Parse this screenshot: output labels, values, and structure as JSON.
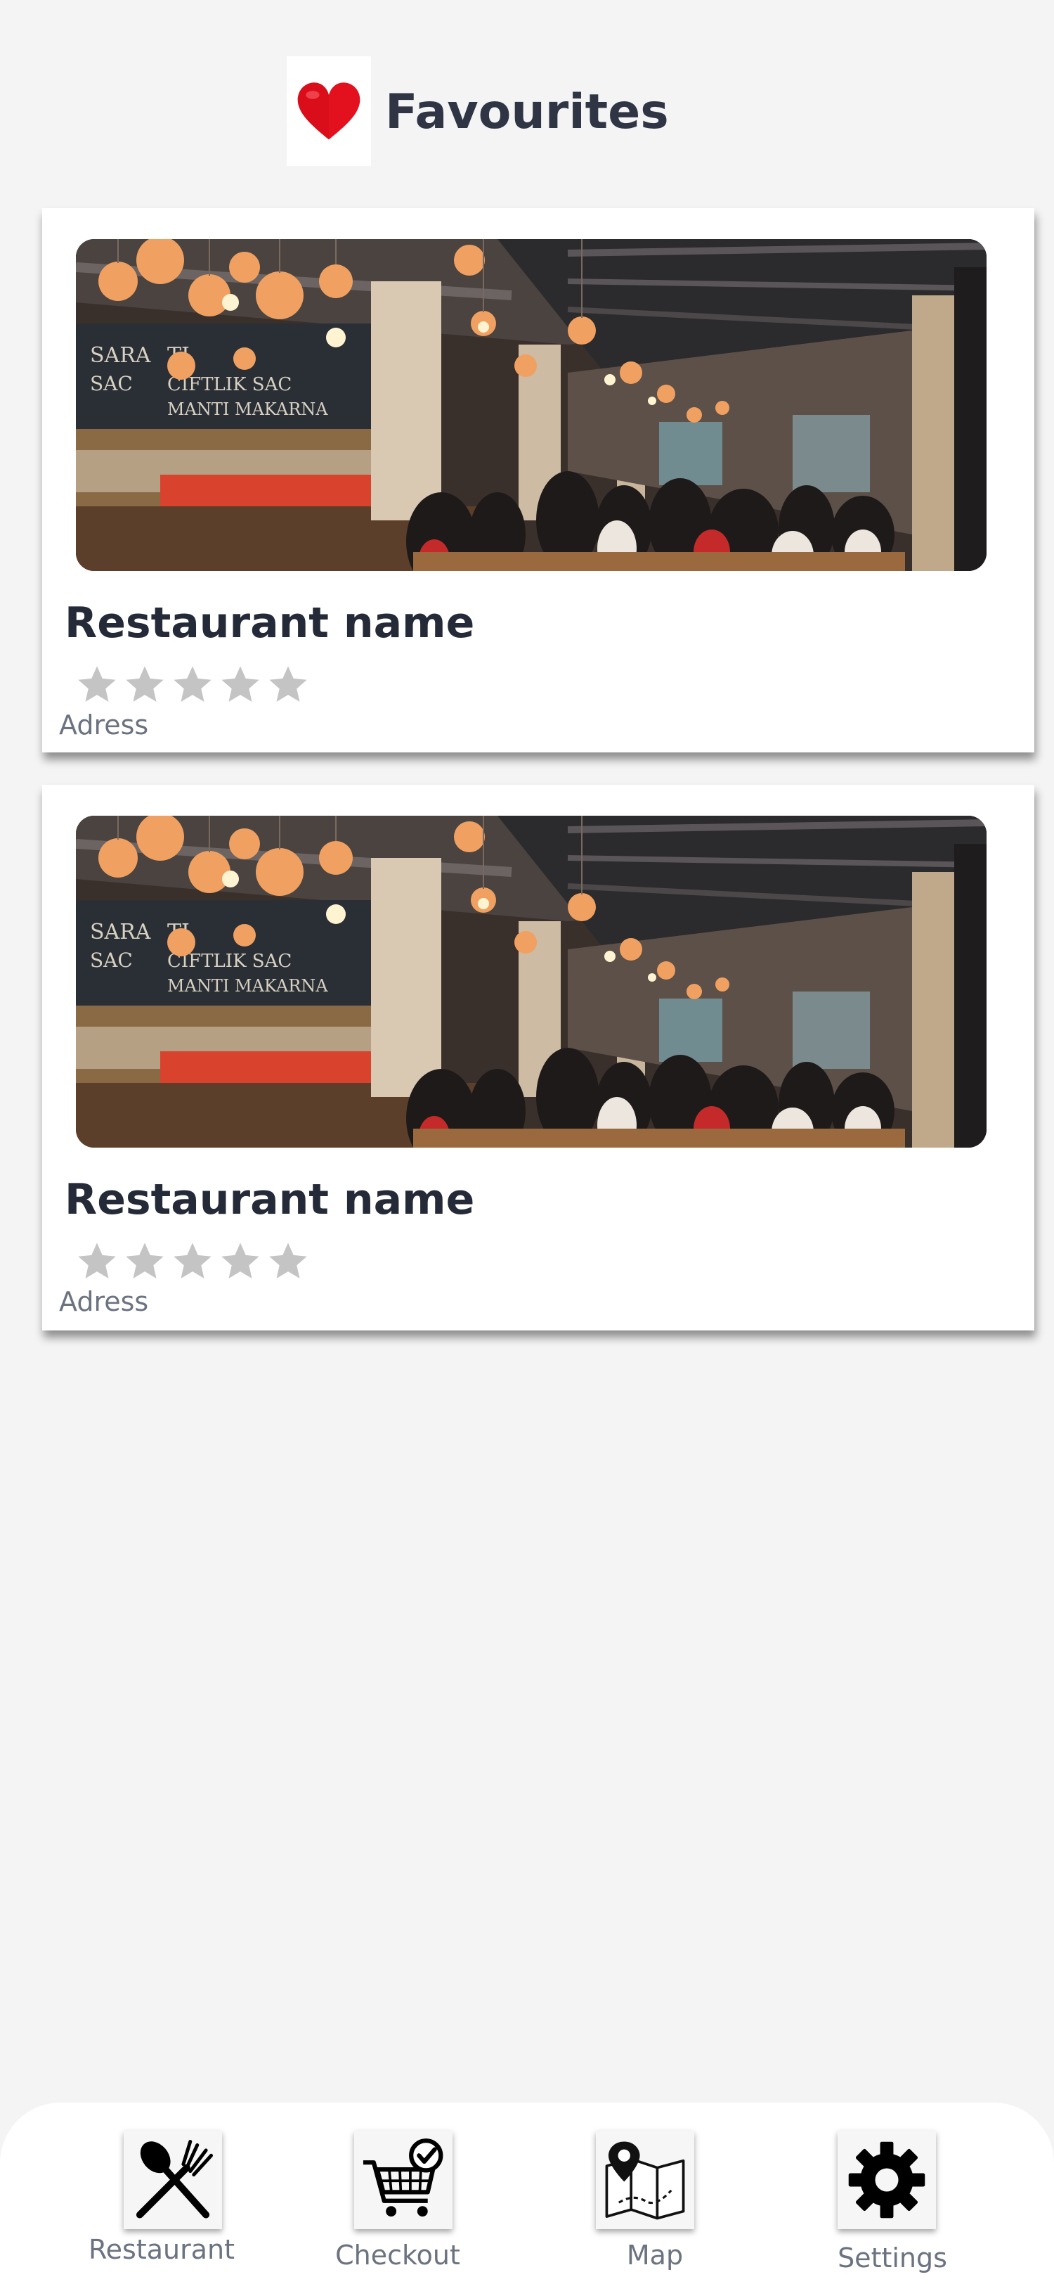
{
  "header": {
    "title": "Favourites",
    "icon": "heart-icon",
    "icon_color": "#e3101e"
  },
  "favourites": [
    {
      "name": "Restaurant name",
      "rating": 0,
      "max_rating": 5,
      "address": "Adress",
      "image": "restaurant-interior-photo"
    },
    {
      "name": "Restaurant name",
      "rating": 0,
      "max_rating": 5,
      "address": "Adress",
      "image": "restaurant-interior-photo"
    }
  ],
  "bottom_nav": {
    "items": [
      {
        "label": "Restaurant",
        "icon": "fork-knife-icon"
      },
      {
        "label": "Checkout",
        "icon": "cart-check-icon"
      },
      {
        "label": "Map",
        "icon": "map-icon"
      },
      {
        "label": "Settings",
        "icon": "gear-icon"
      }
    ]
  },
  "colors": {
    "background": "#f4f4f4",
    "card": "#ffffff",
    "title_text": "#242a37",
    "secondary_text": "#6b7280",
    "star_empty": "#c4c4c4"
  }
}
